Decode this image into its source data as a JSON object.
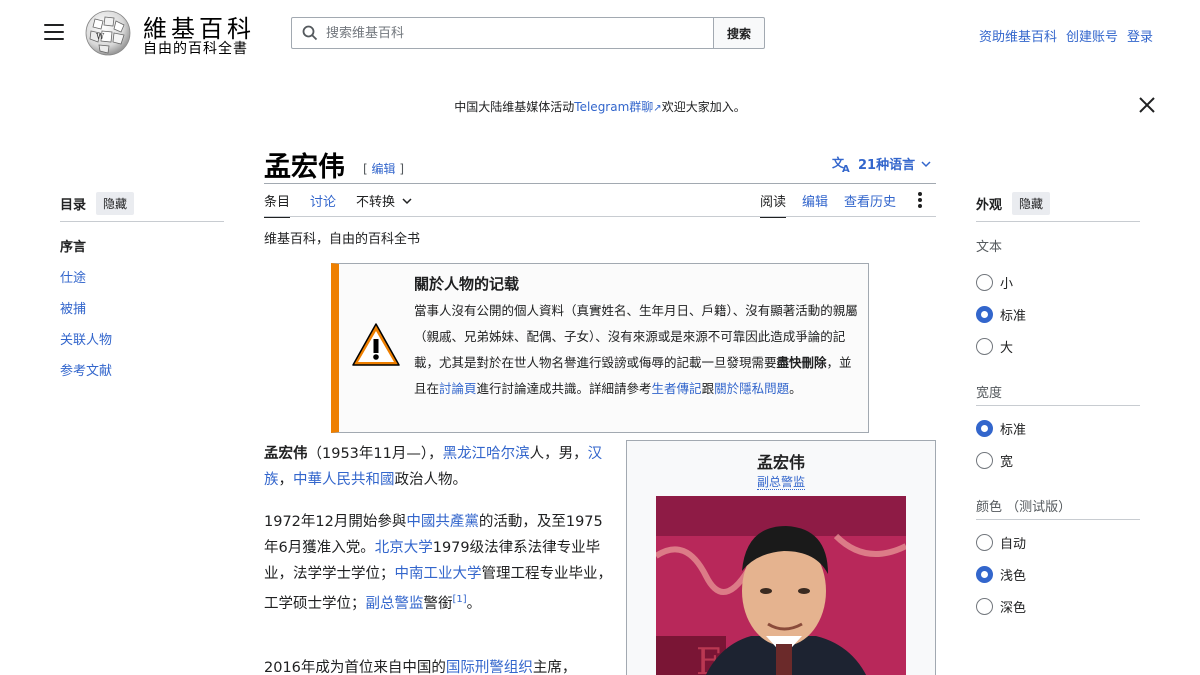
{
  "header": {
    "logo_title": "維基百科",
    "logo_tagline": "自由的百科全書",
    "search_placeholder": "搜索维基百科",
    "search_button": "搜索",
    "user_links": [
      "资助维基百科",
      "创建账号",
      "登录"
    ]
  },
  "banner": {
    "text_before": "中国大陆维基媒体活动",
    "link": "Telegram群聊",
    "text_after": "欢迎大家加入。"
  },
  "page": {
    "title": "孟宏伟",
    "edit_open": "[",
    "edit_label": "编辑",
    "edit_close": "]",
    "languages": "21种语言",
    "tabs_left": [
      "条目",
      "讨论",
      "不转换"
    ],
    "tabs_right": [
      "阅读",
      "编辑",
      "查看历史"
    ],
    "site_sub": "维基百科，自由的百科全书"
  },
  "toc": {
    "title": "目录",
    "hide": "隐藏",
    "items": [
      "序言",
      "仕途",
      "被捕",
      "关联人物",
      "参考文献"
    ]
  },
  "appearance": {
    "title": "外观",
    "hide": "隐藏",
    "text_label": "文本",
    "text_options": [
      "小",
      "标准",
      "大"
    ],
    "width_label": "宽度",
    "width_options": [
      "标准",
      "宽"
    ],
    "color_label": "颜色",
    "color_note": "（测试版）",
    "color_options": [
      "自动",
      "浅色",
      "深色"
    ]
  },
  "ambox": {
    "title": "關於人物的记载",
    "t1": "當事人沒有公開的個人資料（真實姓名、生年月日、戶籍）、沒有顯著活動的親屬（親戚、兄弟姊妹、配偶、子女）、沒有來源或是來源不可靠因此造成爭論的記載，尤其是對於在世人物名譽進行毀謗或侮辱的記載一旦發現需要",
    "t2": "盡快刪除",
    "t3": "，並且在",
    "l1": "討論頁",
    "t4": "進行討論達成共識。詳細請參考",
    "l2": "生者傳記",
    "t5": "跟",
    "l3": "關於隱私問題",
    "t6": "。"
  },
  "infobox": {
    "name": "孟宏伟",
    "title": "副总警监"
  },
  "body": {
    "p1": {
      "name": "孟宏伟",
      "a": "（1953年11月—），",
      "l1": "黑龙江哈尔滨",
      "b": "人，男，",
      "l2": "汉族",
      "c": "，",
      "l3": "中華人民共和國",
      "d": "政治人物。"
    },
    "p2": {
      "a": "1972年12月開始參與",
      "l1": "中國共產黨",
      "b": "的活動，及至1975年6月獲准入党。",
      "l2": "北京大学",
      "c": "1979级法律系法律专业毕业，法学学士学位；",
      "l3": "中南工业大学",
      "d": "管理工程专业毕业，工学硕士学位；",
      "l4": "副总警监",
      "e": "警銜",
      "ref": "[1]",
      "f": "。"
    },
    "p3": {
      "a": "2016年成为首位来自中国的",
      "l1": "国际刑警组织",
      "b": "主席，"
    }
  },
  "colors": {
    "link": "#3366cc",
    "ambox_accent": "#ee7f00"
  }
}
